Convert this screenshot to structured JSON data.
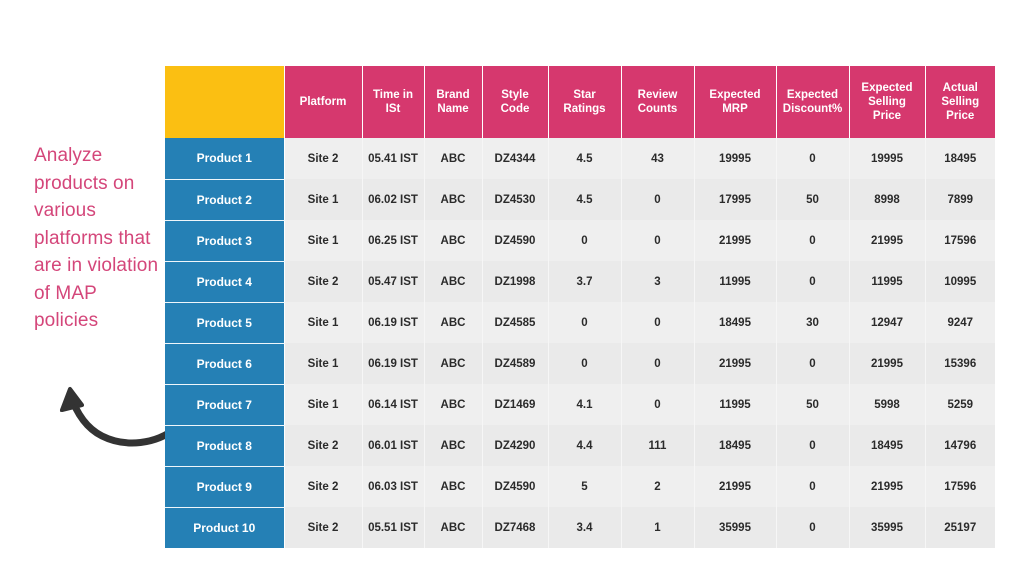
{
  "annotation": {
    "text": "Analyze products on various platforms that are in violation of MAP policies",
    "color": "#d4467a",
    "arrow_icon": "curved-arrow-up-left-icon",
    "arrow_color": "#333333"
  },
  "table": {
    "corner_cell_label": "",
    "colors": {
      "header_bg": "#d6386e",
      "corner_bg": "#fbbf12",
      "row_label_bg": "#2580b5",
      "row_bg_odd": "#efefef",
      "row_bg_even": "#eaeaea",
      "header_text": "#ffffff",
      "body_text": "#2b2b2b"
    },
    "headers": [
      "",
      "Platform",
      "Time in ISt",
      "Brand Name",
      "Style Code",
      "Star Ratings",
      "Review Counts",
      "Expected MRP",
      "Expected Discount%",
      "Expected Selling Price",
      "Actual Selling Price"
    ],
    "rows": [
      {
        "product": "Product 1",
        "platform": "Site 2",
        "time": "05.41 IST",
        "brand": "ABC",
        "style": "DZ4344",
        "stars": "4.5",
        "reviews": "43",
        "mrp": "19995",
        "discount": "0",
        "expected_price": "19995",
        "actual_price": "18495"
      },
      {
        "product": "Product 2",
        "platform": "Site 1",
        "time": "06.02 IST",
        "brand": "ABC",
        "style": "DZ4530",
        "stars": "4.5",
        "reviews": "0",
        "mrp": "17995",
        "discount": "50",
        "expected_price": "8998",
        "actual_price": "7899"
      },
      {
        "product": "Product 3",
        "platform": "Site 1",
        "time": "06.25 IST",
        "brand": "ABC",
        "style": "DZ4590",
        "stars": "0",
        "reviews": "0",
        "mrp": "21995",
        "discount": "0",
        "expected_price": "21995",
        "actual_price": "17596"
      },
      {
        "product": "Product 4",
        "platform": "Site 2",
        "time": "05.47 IST",
        "brand": "ABC",
        "style": "DZ1998",
        "stars": "3.7",
        "reviews": "3",
        "mrp": "11995",
        "discount": "0",
        "expected_price": "11995",
        "actual_price": "10995"
      },
      {
        "product": "Product 5",
        "platform": "Site 1",
        "time": "06.19 IST",
        "brand": "ABC",
        "style": "DZ4585",
        "stars": "0",
        "reviews": "0",
        "mrp": "18495",
        "discount": "30",
        "expected_price": "12947",
        "actual_price": "9247"
      },
      {
        "product": "Product 6",
        "platform": "Site 1",
        "time": "06.19 IST",
        "brand": "ABC",
        "style": "DZ4589",
        "stars": "0",
        "reviews": "0",
        "mrp": "21995",
        "discount": "0",
        "expected_price": "21995",
        "actual_price": "15396"
      },
      {
        "product": "Product 7",
        "platform": "Site 1",
        "time": "06.14 IST",
        "brand": "ABC",
        "style": "DZ1469",
        "stars": "4.1",
        "reviews": "0",
        "mrp": "11995",
        "discount": "50",
        "expected_price": "5998",
        "actual_price": "5259"
      },
      {
        "product": "Product 8",
        "platform": "Site 2",
        "time": "06.01 IST",
        "brand": "ABC",
        "style": "DZ4290",
        "stars": "4.4",
        "reviews": "111",
        "mrp": "18495",
        "discount": "0",
        "expected_price": "18495",
        "actual_price": "14796"
      },
      {
        "product": "Product 9",
        "platform": "Site 2",
        "time": "06.03 IST",
        "brand": "ABC",
        "style": "DZ4590",
        "stars": "5",
        "reviews": "2",
        "mrp": "21995",
        "discount": "0",
        "expected_price": "21995",
        "actual_price": "17596"
      },
      {
        "product": "Product 10",
        "platform": "Site 2",
        "time": "05.51 IST",
        "brand": "ABC",
        "style": "DZ7468",
        "stars": "3.4",
        "reviews": "1",
        "mrp": "35995",
        "discount": "0",
        "expected_price": "35995",
        "actual_price": "25197"
      }
    ]
  }
}
